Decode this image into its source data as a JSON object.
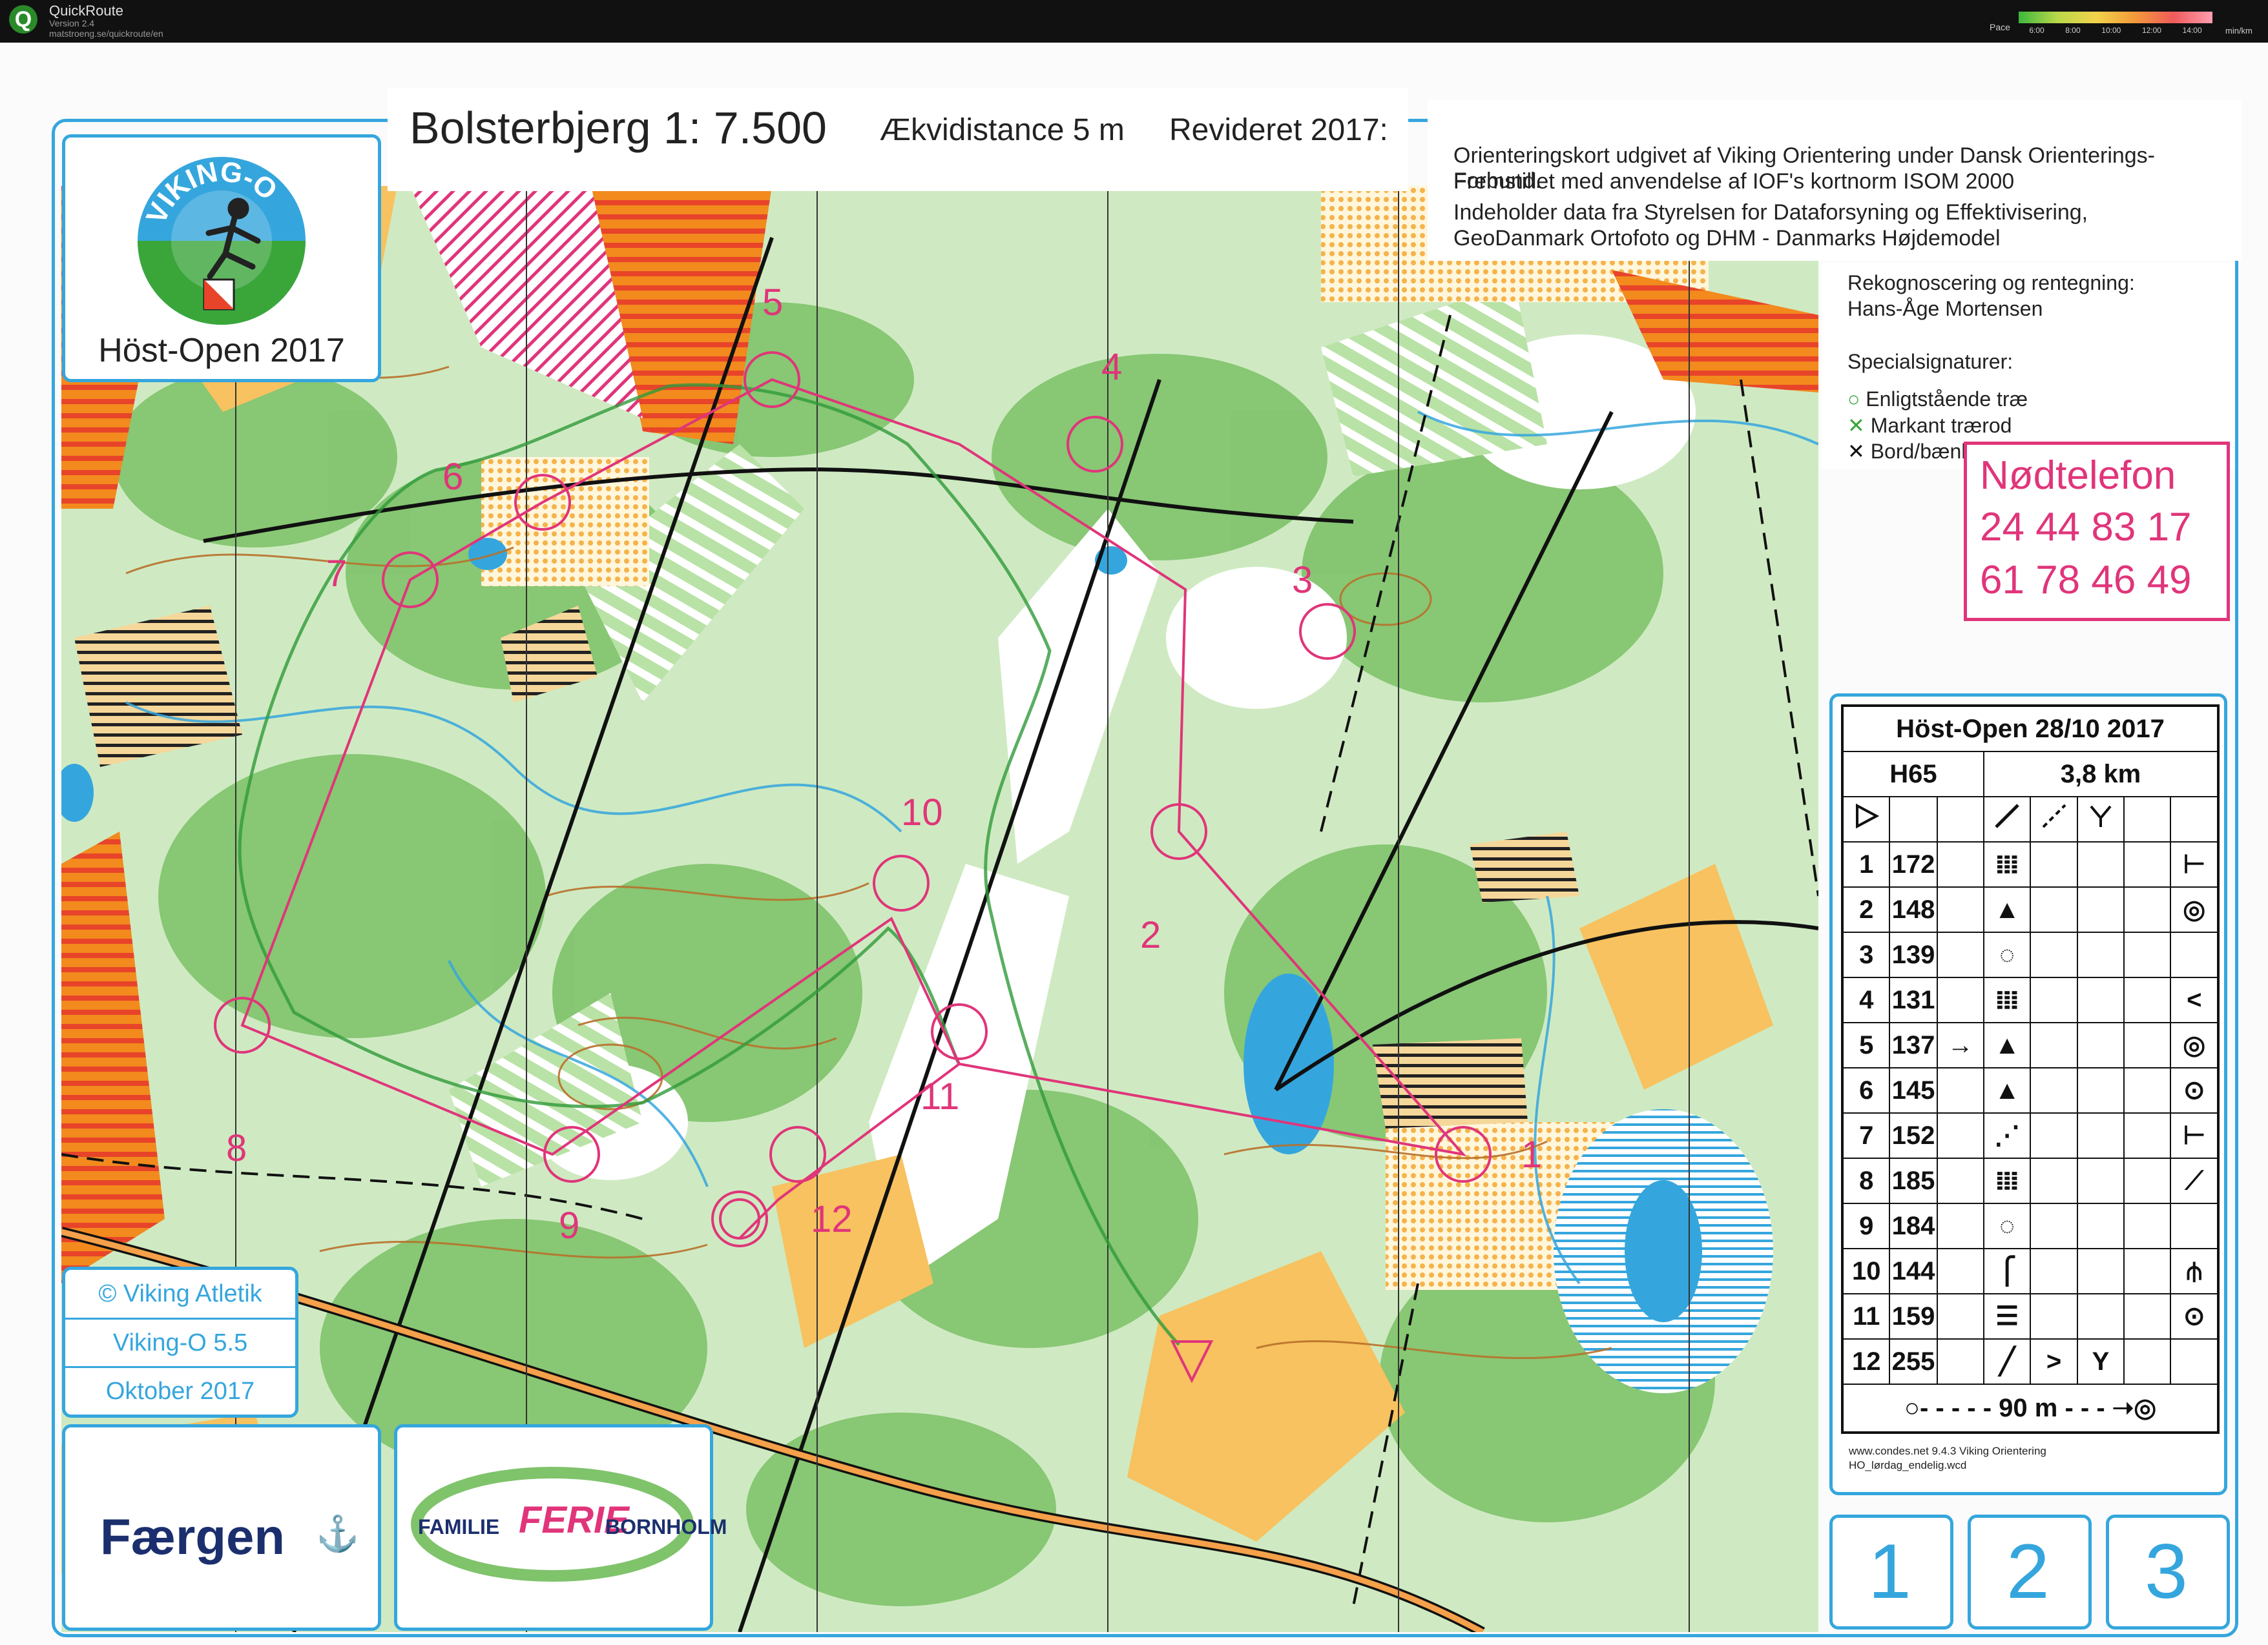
{
  "app": {
    "name": "QuickRoute",
    "version": "Version 2.4",
    "url": "matstroeng.se/quickroute/en"
  },
  "pace_legend": {
    "label": "Pace",
    "ticks": [
      "6:00",
      "8:00",
      "10:00",
      "12:00",
      "14:00"
    ],
    "unit": "min/km"
  },
  "header": {
    "title": "Bolsterbjerg 1: 7.500",
    "contour": "Ækvidistance 5 m",
    "revised": "Revideret 2017:",
    "info_lines": [
      "Orienteringskort udgivet af Viking Orientering under Dansk Orienterings-Forbund.",
      "Fremstillet med anvendelse af IOF's kortnorm ISOM 2000",
      "Indeholder data fra Styrelsen for Dataforsyning og Effektivisering,",
      "GeoDanmark Ortofoto og DHM - Danmarks Højdemodel"
    ],
    "survey_label": "Rekognoscering og rentegning:",
    "survey_name": "Hans-Åge Mortensen",
    "special_label": "Specialsignaturer:",
    "special_items": [
      "Enligtstående træ",
      "Markant trærod",
      "Bord/bænk sæt"
    ]
  },
  "logo": {
    "ring_text": "VIKING-O",
    "event": "Höst-Open 2017"
  },
  "emergency": {
    "label": "Nødtelefon",
    "numbers": [
      "24 44 83 17",
      "61 78 46 49"
    ]
  },
  "course": {
    "event": "Höst-Open 28/10 2017",
    "class": "H65",
    "length": "3,8 km",
    "finish": "90 m",
    "controls": [
      {
        "n": "1",
        "code": "172"
      },
      {
        "n": "2",
        "code": "148"
      },
      {
        "n": "3",
        "code": "139"
      },
      {
        "n": "4",
        "code": "131"
      },
      {
        "n": "5",
        "code": "137"
      },
      {
        "n": "6",
        "code": "145"
      },
      {
        "n": "7",
        "code": "152"
      },
      {
        "n": "8",
        "code": "185"
      },
      {
        "n": "9",
        "code": "184"
      },
      {
        "n": "10",
        "code": "144"
      },
      {
        "n": "11",
        "code": "159"
      },
      {
        "n": "12",
        "code": "255"
      }
    ],
    "software": "www.condes.net 9.4.3 Viking Orientering",
    "file": "HO_lørdag_endelig.wcd"
  },
  "copyright": {
    "line1": "© Viking Atletik",
    "line2": "Viking-O 5.5",
    "line3": "Oktober 2017"
  },
  "sponsors": {
    "s1": "Færgen",
    "s2_a": "FAMILIE",
    "s2_b": "FERIE",
    "s2_c": "BORNHOLM"
  },
  "map_sections": [
    "1",
    "2",
    "3"
  ],
  "control_labels": [
    "1",
    "2",
    "3",
    "4",
    "5",
    "6",
    "7",
    "8",
    "9",
    "10",
    "11",
    "12"
  ],
  "colors": {
    "course": "#e0357a",
    "water": "#35a6dd",
    "forest": "#7fc36b",
    "open": "#f5b34a",
    "contour": "#b8702a"
  }
}
